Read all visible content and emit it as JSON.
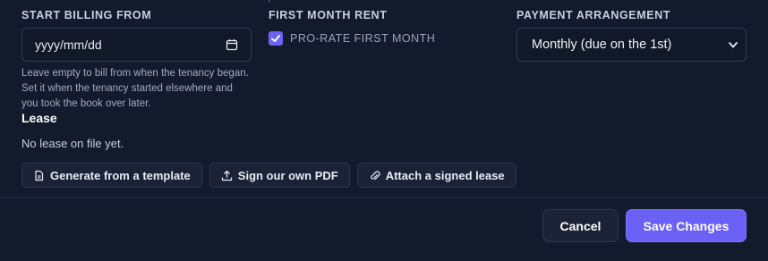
{
  "billing": {
    "label": "START BILLING FROM",
    "date_placeholder": "yyyy/mm/dd",
    "help": "Leave empty to bill from when the tenancy began. Set it when the tenancy started elsewhere and you took the book over later."
  },
  "first_month": {
    "label": "FIRST MONTH RENT",
    "checkbox_label": "PRO-RATE FIRST MONTH",
    "checked": true
  },
  "arrangement": {
    "label": "PAYMENT ARRANGEMENT",
    "selected": "Monthly (due on the 1st)"
  },
  "lease": {
    "title": "Lease",
    "empty_text": "No lease on file yet.",
    "actions": [
      {
        "label": "Generate from a template",
        "icon": "document-icon"
      },
      {
        "label": "Sign our own PDF",
        "icon": "upload-icon"
      },
      {
        "label": "Attach a signed lease",
        "icon": "paperclip-icon"
      }
    ]
  },
  "footer": {
    "cancel_label": "Cancel",
    "save_label": "Save Changes"
  },
  "colors": {
    "background": "#131a2b",
    "accent": "#6a60f5",
    "checkbox": "#6b63f6"
  }
}
